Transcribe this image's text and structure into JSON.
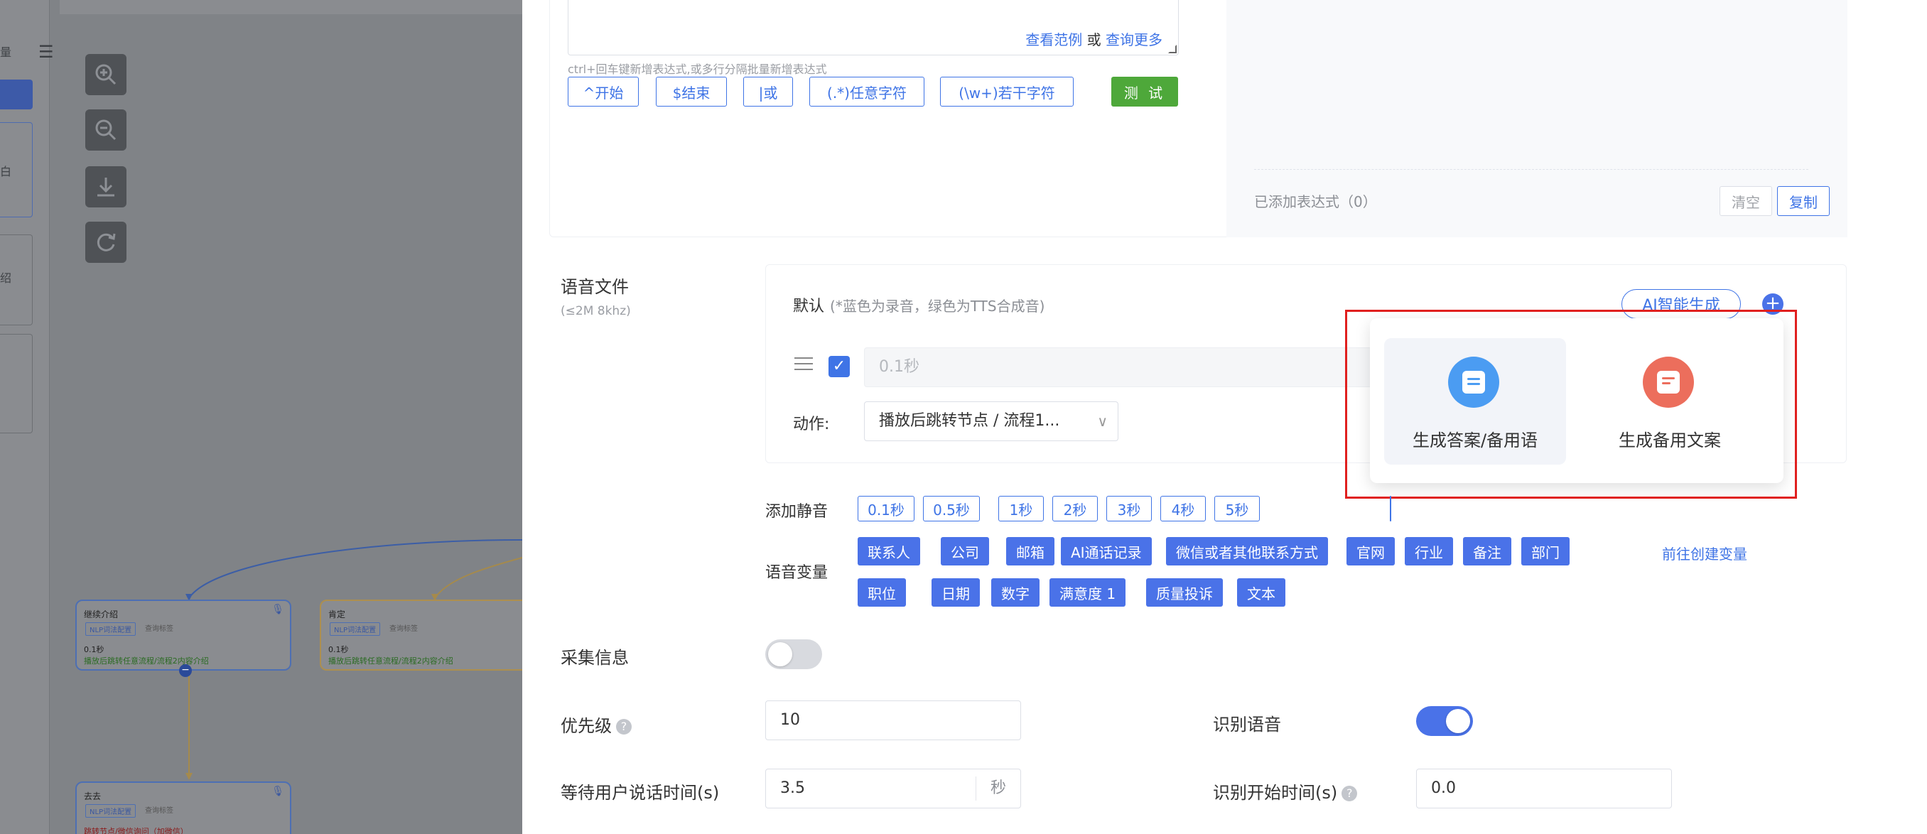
{
  "canvas": {
    "left_chars": [
      "量",
      "白",
      "绍"
    ],
    "nodes": [
      {
        "title": "继续介绍",
        "tag1": "NLP词法配置",
        "tag2": "查询标签",
        "duration": "0.1秒",
        "action": "播放后跳转任意流程/流程2内容介绍"
      },
      {
        "title": "肯定",
        "tag1": "NLP词法配置",
        "tag2": "查询标签",
        "duration": "0.1秒",
        "action": "播放后跳转任意流程/流程2内容介绍"
      },
      {
        "title": "去去",
        "tag1": "NLP词法配置",
        "tag2": "查询标签",
        "duration": "",
        "action": "跳转节点/微信询问（加微信）"
      }
    ]
  },
  "regex": {
    "link_examples": "查看范例",
    "link_or": "或",
    "link_more": "查询更多",
    "hint": "ctrl+回车键新增表达式,或多行分隔批量新增表达式",
    "buttons": [
      "^开始",
      "$结束",
      "|或",
      "(.*)任意字符",
      "(\\w+)若干字符"
    ],
    "test_label": "测 试",
    "count_label": "已添加表达式（0）",
    "clear_label": "清空",
    "copy_label": "复制"
  },
  "voice": {
    "label": "语音文件",
    "sublabel": "(≤2M 8khz)",
    "default_label": "默认",
    "default_note": "(*蓝色为录音，绿色为TTS合成音)",
    "ai_button": "AI智能生成",
    "duration_placeholder": "0.1秒",
    "action_label": "动作:",
    "action_value": "播放后跳转节点 / 流程1...",
    "popup": {
      "item1": "生成答案/备用语",
      "item2": "生成备用文案"
    }
  },
  "silence": {
    "label": "添加静音",
    "options": [
      "0.1秒",
      "0.5秒",
      "1秒",
      "2秒",
      "3秒",
      "4秒",
      "5秒"
    ]
  },
  "variables": {
    "label": "语音变量",
    "row1": [
      "联系人",
      "公司",
      "邮箱",
      "AI通话记录",
      "微信或者其他联系方式",
      "官网",
      "行业",
      "备注",
      "部门"
    ],
    "row2": [
      "职位",
      "日期",
      "数字",
      "满意度 1",
      "质量投诉",
      "文本"
    ],
    "create_link": "前往创建变量"
  },
  "collect": {
    "label": "采集信息",
    "enabled": false
  },
  "priority": {
    "label": "优先级",
    "help": "?",
    "value": "10"
  },
  "recognize": {
    "label": "识别语音",
    "enabled": true
  },
  "wait_time": {
    "label": "等待用户说话时间(s)",
    "value": "3.5",
    "unit": "秒"
  },
  "recognize_start": {
    "label": "识别开始时间(s)",
    "help": "?",
    "value": "0.0"
  },
  "colors": {
    "primary": "#3f74e6",
    "success": "#4ea83a",
    "highlight_box": "#e0201f",
    "popup_icon_blue": "#4b9cf2",
    "popup_icon_red": "#ec6e5c"
  }
}
